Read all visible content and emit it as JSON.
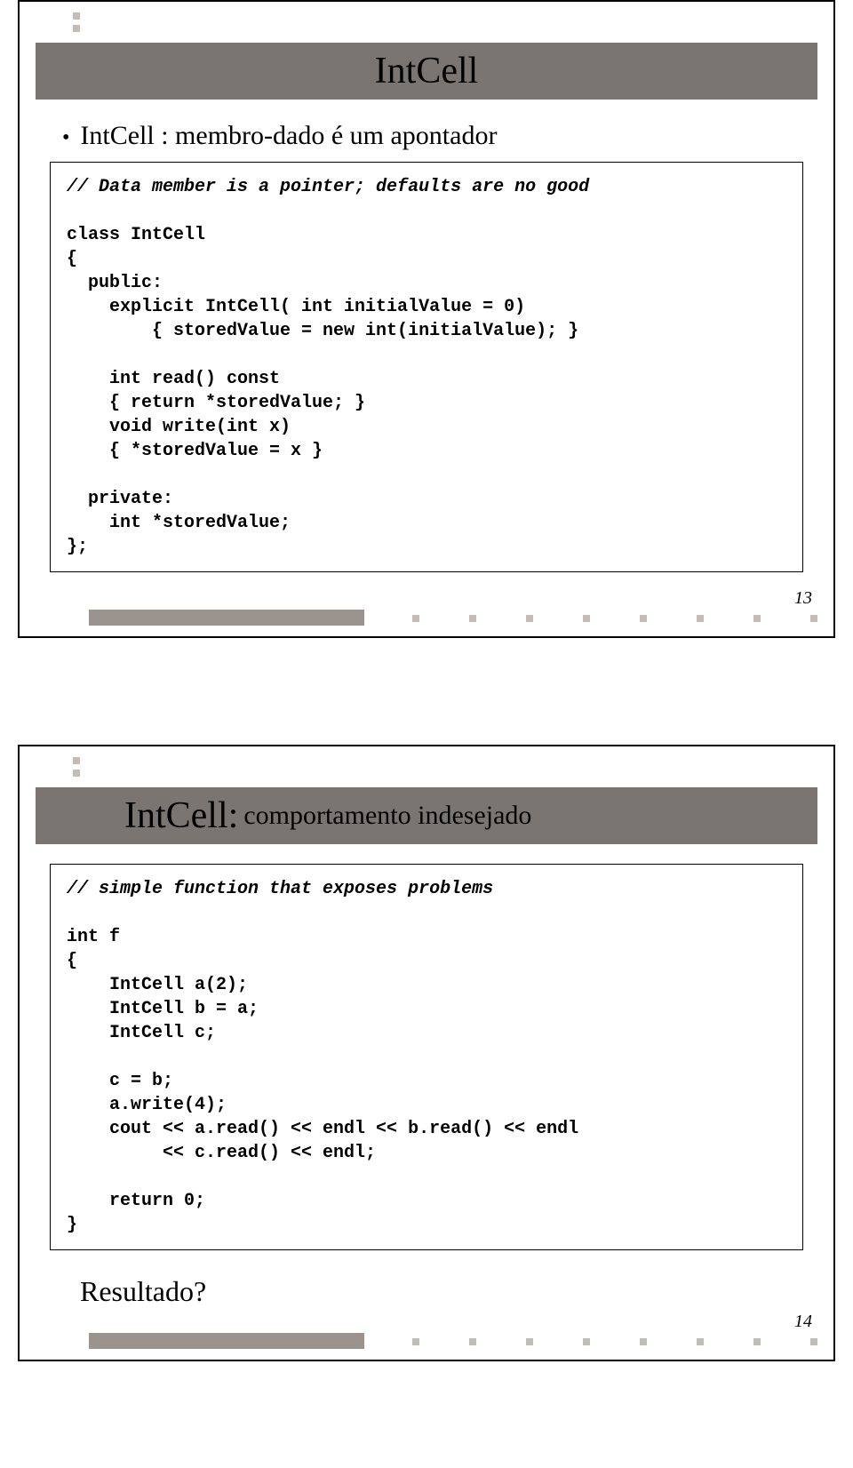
{
  "slide1": {
    "title": "IntCell",
    "bullet": "IntCell : membro-dado é um apontador",
    "code_comment": "// Data member is a pointer; defaults are no good",
    "code_body": "class IntCell\n{\n  public:\n    explicit IntCell( int initialValue = 0)\n        { storedValue = new int(initialValue); }\n\n    int read() const\n    { return *storedValue; }\n    void write(int x)\n    { *storedValue = x }\n\n  private:\n    int *storedValue;\n};",
    "page": "13"
  },
  "slide2": {
    "title_main": "IntCell:",
    "title_sub": "comportamento indesejado",
    "code_comment": "// simple function that exposes problems",
    "code_body": "int f\n{\n    IntCell a(2);\n    IntCell b = a;\n    IntCell c;\n\n    c = b;\n    a.write(4);\n    cout << a.read() << endl << b.read() << endl\n         << c.read() << endl;\n\n    return 0;\n}",
    "result_label": "Resultado?",
    "page": "14"
  }
}
